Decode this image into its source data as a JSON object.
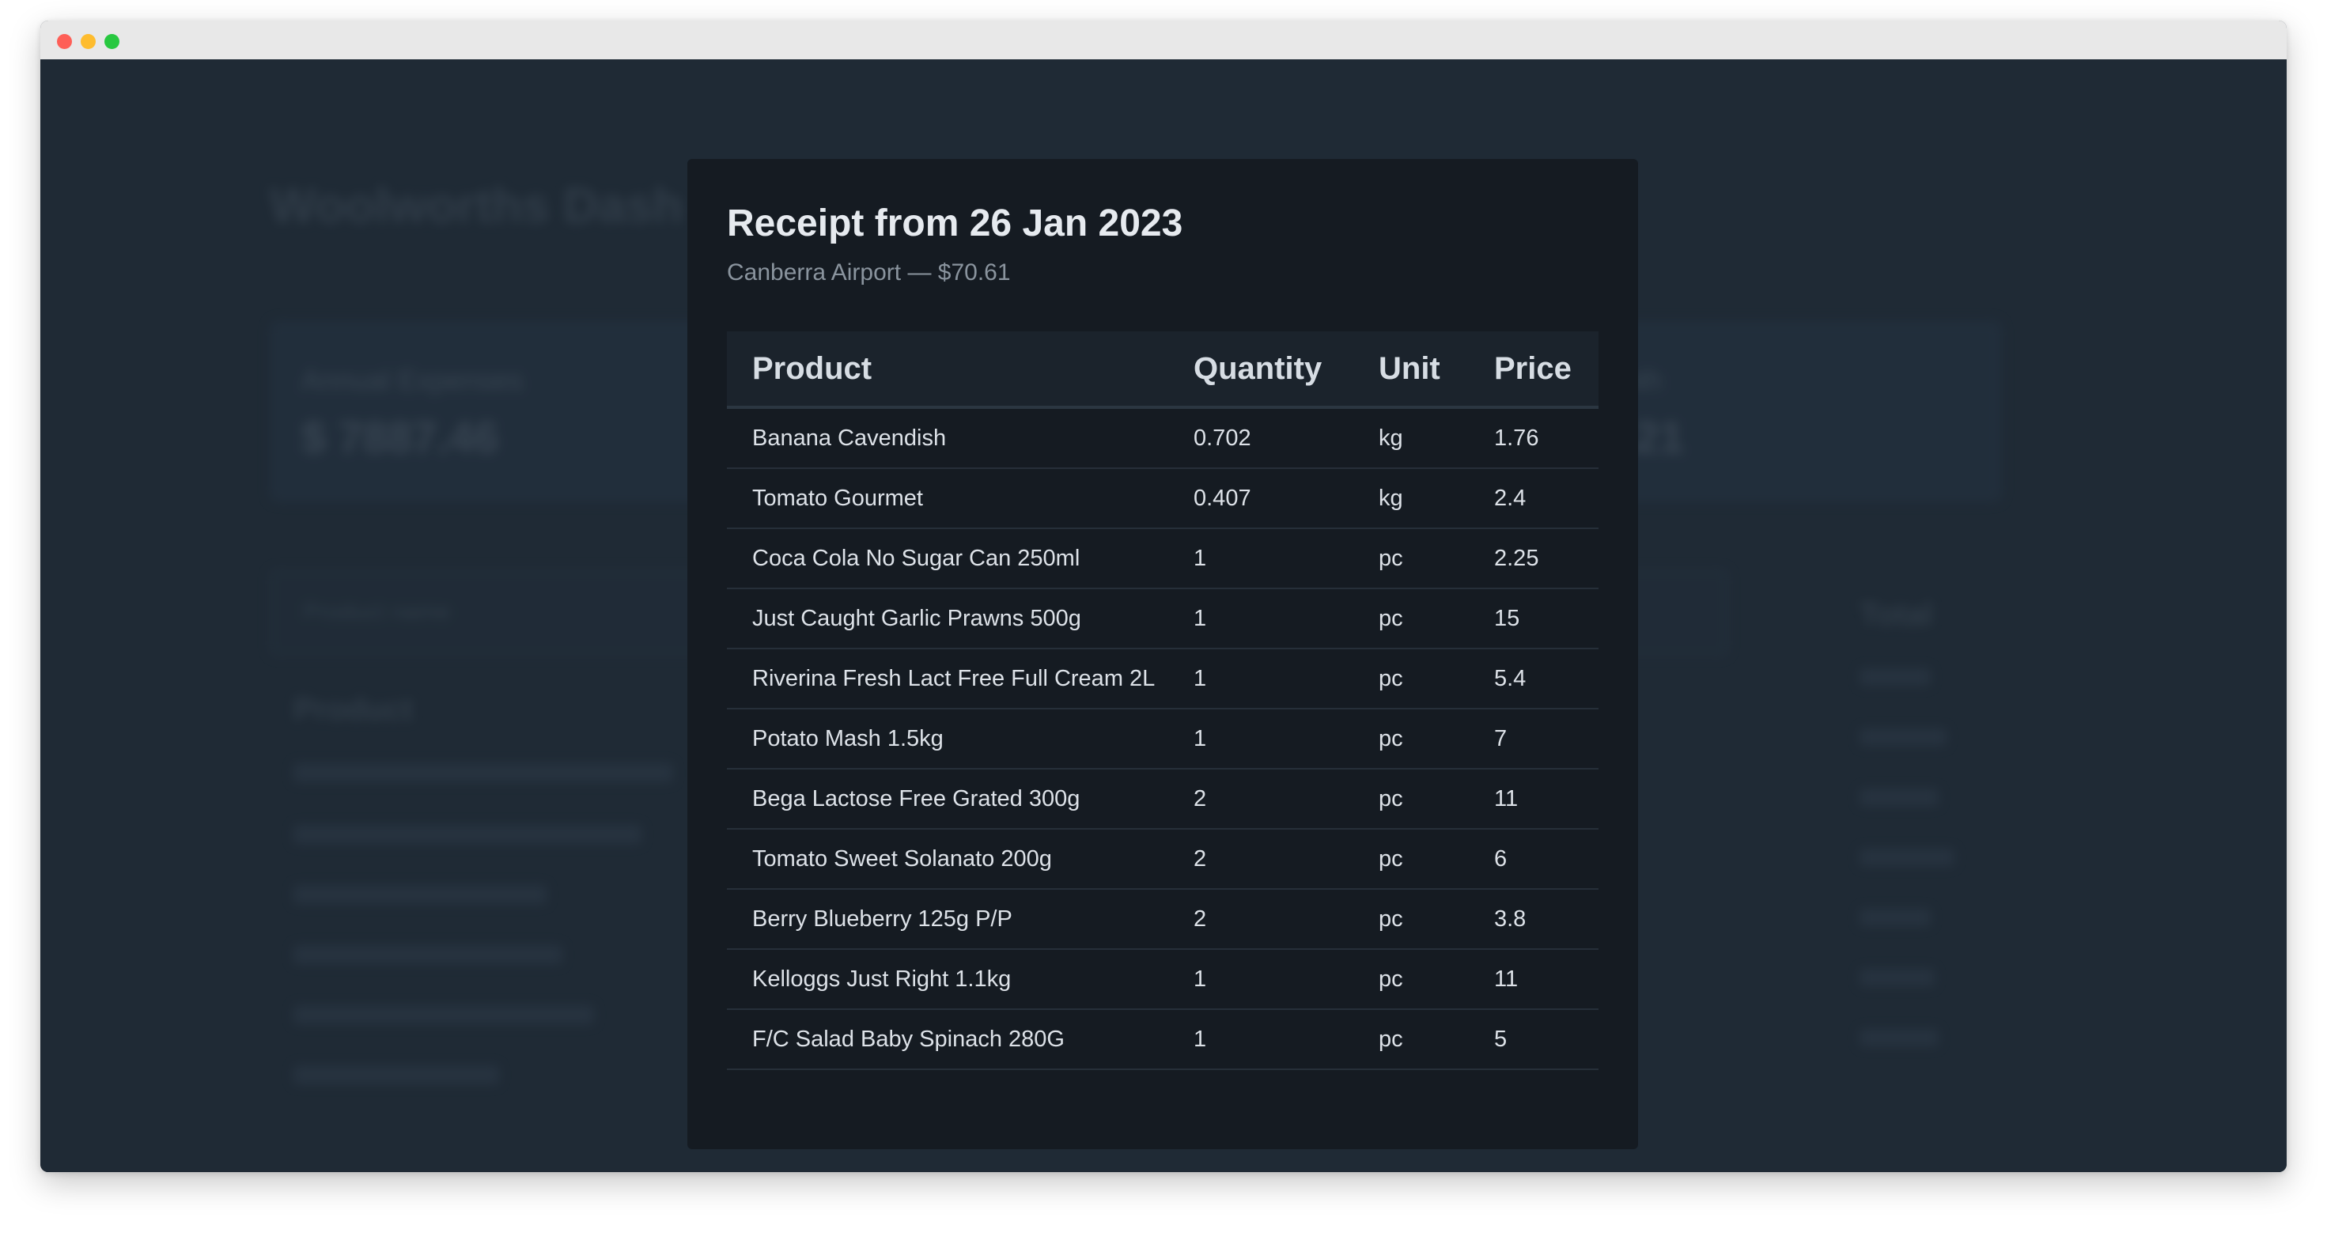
{
  "modal": {
    "title": "Receipt from 26 Jan 2023",
    "subtitle": "Canberra Airport — $70.61",
    "columns": [
      "Product",
      "Quantity",
      "Unit",
      "Price"
    ],
    "rows": [
      {
        "product": "Banana Cavendish",
        "quantity": "0.702",
        "unit": "kg",
        "price": "1.76"
      },
      {
        "product": "Tomato Gourmet",
        "quantity": "0.407",
        "unit": "kg",
        "price": "2.4"
      },
      {
        "product": "Coca Cola No Sugar Can 250ml",
        "quantity": "1",
        "unit": "pc",
        "price": "2.25"
      },
      {
        "product": "Just Caught Garlic Prawns 500g",
        "quantity": "1",
        "unit": "pc",
        "price": "15"
      },
      {
        "product": "Riverina Fresh Lact Free Full Cream 2L",
        "quantity": "1",
        "unit": "pc",
        "price": "5.4"
      },
      {
        "product": "Potato Mash 1.5kg",
        "quantity": "1",
        "unit": "pc",
        "price": "7"
      },
      {
        "product": "Bega Lactose Free Grated 300g",
        "quantity": "2",
        "unit": "pc",
        "price": "11"
      },
      {
        "product": "Tomato Sweet Solanato 200g",
        "quantity": "2",
        "unit": "pc",
        "price": "6"
      },
      {
        "product": "Berry Blueberry 125g P/P",
        "quantity": "2",
        "unit": "pc",
        "price": "3.8"
      },
      {
        "product": "Kelloggs Just Right 1.1kg",
        "quantity": "1",
        "unit": "pc",
        "price": "11"
      },
      {
        "product": "F/C Salad Baby Spinach 280G",
        "quantity": "1",
        "unit": "pc",
        "price": "5"
      }
    ]
  },
  "background": {
    "title": "Woolworths Dash",
    "annual_card": {
      "label": "Annual Expenses",
      "value": "$ 7887.46"
    },
    "month_card": {
      "label": "nth",
      "value": ".21"
    },
    "search_placeholder": "Product name",
    "product_header": "Product",
    "total_header": "Total"
  },
  "colors": {
    "app_background": "#1f2a35",
    "modal_background": "#151b22",
    "title_text": "#e6eaef",
    "subtitle_text": "#8a949e"
  }
}
